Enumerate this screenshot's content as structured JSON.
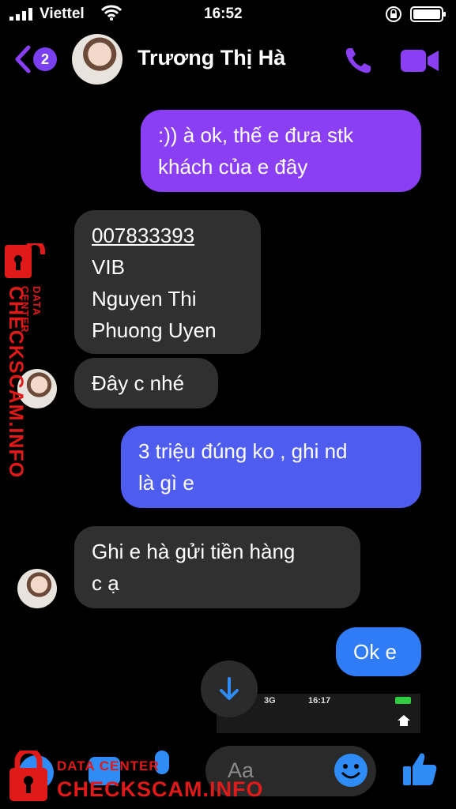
{
  "status_bar": {
    "carrier": "Viettel",
    "time": "16:52"
  },
  "header": {
    "back_count": "2",
    "contact_name": "Trương Thị Hà"
  },
  "messages": [
    {
      "lines": [
        ":)) à ok, thế e đưa stk",
        "khách của e đây"
      ]
    },
    {
      "lines": [
        "007833393",
        "VIB",
        "Nguyen Thi",
        "Phuong Uyen"
      ]
    },
    {
      "lines": [
        "Đây c nhé"
      ]
    },
    {
      "lines": [
        "3 triệu đúng ko , ghi nd",
        "là gì e"
      ]
    },
    {
      "lines": [
        "Ghi e hà gửi tiền hàng",
        "c ạ"
      ]
    },
    {
      "lines": [
        "Ok e"
      ]
    }
  ],
  "thumbnail": {
    "network": "3G",
    "time": "16:17"
  },
  "composer": {
    "placeholder": "Aa"
  },
  "watermark": {
    "label_small": "DATA CENTER",
    "label_big": "CHECKSCAM.INFO"
  },
  "colors": {
    "accent": "#8a3ff5",
    "bubble_in": "#303030",
    "bubble_blue": "#4f5cf0"
  }
}
